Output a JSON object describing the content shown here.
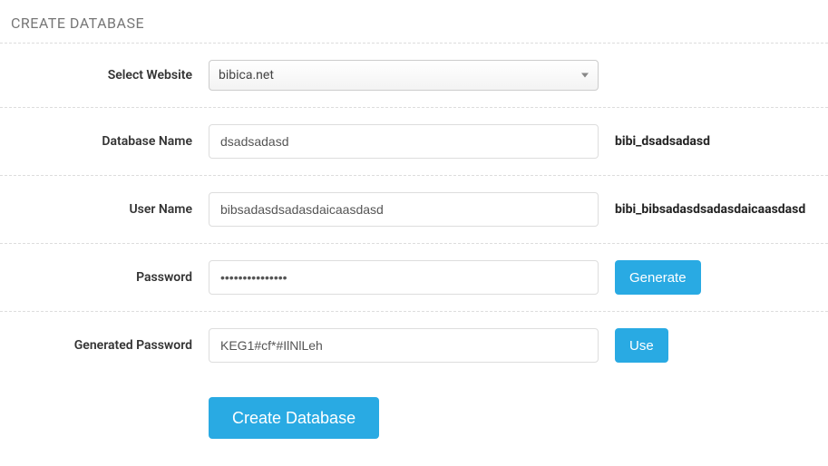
{
  "title": "CREATE DATABASE",
  "fields": {
    "website": {
      "label": "Select Website",
      "value": "bibica.net"
    },
    "dbname": {
      "label": "Database Name",
      "value": "dsadsadasd",
      "fullname": "bibi_dsadsadasd"
    },
    "username": {
      "label": "User Name",
      "value": "bibsadasdsadasdaicaasdasd",
      "fullname": "bibi_bibsadasdsadasdaicaasdasd"
    },
    "password": {
      "label": "Password",
      "value": "•••••••••••••••",
      "generate_label": "Generate"
    },
    "generated": {
      "label": "Generated Password",
      "value": "KEG1#cf*#IlNlLeh",
      "use_label": "Use"
    }
  },
  "submit_label": "Create Database"
}
